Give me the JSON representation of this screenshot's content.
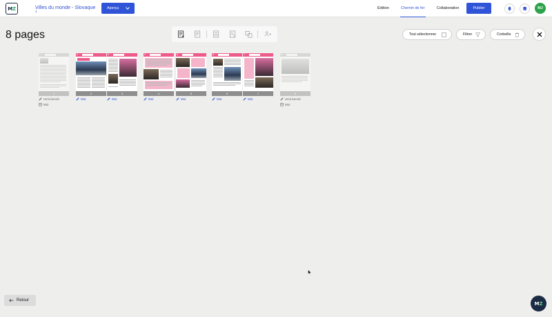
{
  "app": {
    "logo_m": "M",
    "logo_z": "Z"
  },
  "header": {
    "doc_title": "Villes du monde - Slovaque",
    "doc_subtitle": "1",
    "preview_label": "Aperçu",
    "nav": [
      "Édition",
      "Chemin de fer",
      "Collaboration"
    ],
    "active_nav": "Chemin de fer",
    "publish_label": "Publier",
    "avatar_initials": "MJ"
  },
  "main": {
    "page_count": "8 pages",
    "select_all_label": "Tout sélectionner",
    "filter_label": "Filtrer",
    "trash_label": "Corbeille"
  },
  "pages": [
    {
      "number": "1",
      "author": "remi.benoit",
      "editor": "Moi",
      "dimmed": false,
      "author_color": "grey"
    },
    {
      "number": "2",
      "author": "Moi",
      "editor": "",
      "dimmed": false,
      "author_color": "blue"
    },
    {
      "number": "3",
      "author": "Moi",
      "editor": "",
      "dimmed": false,
      "author_color": "blue"
    },
    {
      "number": "4",
      "author": "Moi",
      "editor": "",
      "dimmed": false,
      "author_color": "blue"
    },
    {
      "number": "5",
      "author": "Moi",
      "editor": "",
      "dimmed": false,
      "author_color": "blue"
    },
    {
      "number": "6",
      "author": "Moi",
      "editor": "",
      "dimmed": false,
      "author_color": "blue"
    },
    {
      "number": "7",
      "author": "Moi",
      "editor": "",
      "dimmed": false,
      "author_color": "blue"
    },
    {
      "number": "8",
      "author": "remi.benoit",
      "editor": "Moi",
      "dimmed": true,
      "author_color": "grey"
    }
  ],
  "footer": {
    "back_label": "Retour",
    "help_m": "M",
    "help_z": "Z"
  },
  "colors": {
    "accent": "#2f54d7",
    "pink": "#ee5a8a",
    "avatar": "#2ca24a",
    "navy": "#1b2b44"
  },
  "icons": [
    "bell-icon",
    "book-icon",
    "filter-icon",
    "trash-icon",
    "close-icon",
    "arrow-left-icon",
    "pencil-icon",
    "document-icon",
    "checkbox-icon"
  ]
}
